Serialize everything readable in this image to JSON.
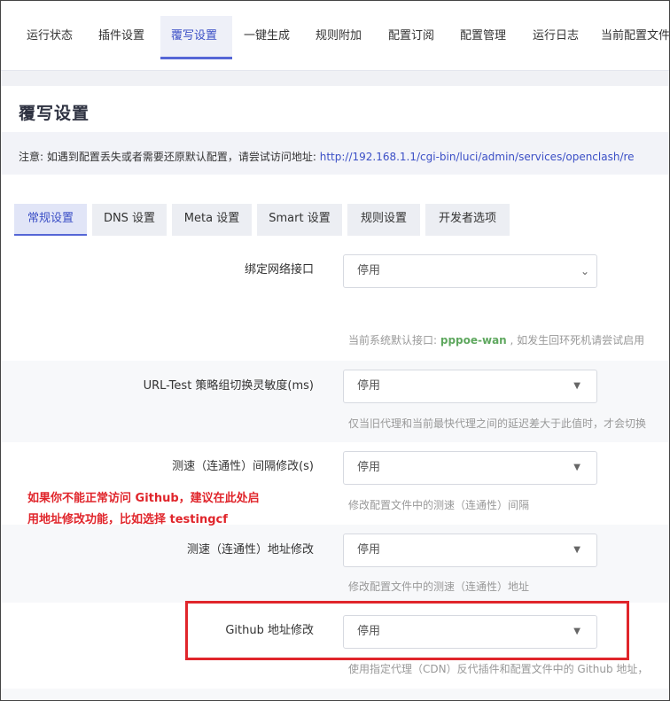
{
  "nav": {
    "items": [
      {
        "label": "运行状态"
      },
      {
        "label": "插件设置"
      },
      {
        "label": "覆写设置"
      },
      {
        "label": "一键生成"
      },
      {
        "label": "规则附加"
      },
      {
        "label": "配置订阅"
      },
      {
        "label": "配置管理"
      },
      {
        "label": "运行日志"
      },
      {
        "label": "当前配置文件"
      }
    ],
    "active_index": 2
  },
  "page": {
    "title": "覆写设置",
    "notice_prefix": "注意: 如遇到配置丢失或者需要还原默认配置，请尝试访问地址: ",
    "notice_link": "http://192.168.1.1/cgi-bin/luci/admin/services/openclash/re"
  },
  "tabs": [
    {
      "label": "常规设置"
    },
    {
      "label": "DNS 设置"
    },
    {
      "label": "Meta 设置"
    },
    {
      "label": "Smart 设置"
    },
    {
      "label": "规则设置"
    },
    {
      "label": "开发者选项"
    }
  ],
  "fields": [
    {
      "label": "绑定网络接口",
      "value": "停用",
      "desc_prefix": "当前系统默认接口: ",
      "desc_highlight": "pppoe-wan",
      "desc_suffix": " , 如发生回环死机请尝试启用"
    },
    {
      "label": "URL-Test 策略组切换灵敏度(ms)",
      "value": "停用",
      "desc": "仅当旧代理和当前最快代理之间的延迟差大于此值时，才会切换"
    },
    {
      "label": "测速（连通性）间隔修改(s)",
      "value": "停用",
      "desc": "修改配置文件中的测速（连通性）间隔"
    },
    {
      "label": "测速（连通性）地址修改",
      "value": "停用",
      "desc": "修改配置文件中的测速（连通性）地址"
    },
    {
      "label": "Github 地址修改",
      "value": "停用",
      "desc": "使用指定代理（CDN）反代插件和配置文件中的 Github 地址，"
    }
  ],
  "annotation": {
    "line1": "如果你不能正常访问 Github，建议在此处启",
    "line2": "用地址修改功能，比如选择 testingcf",
    "color": "#e0252b"
  },
  "colors": {
    "accent": "#3b4fc6",
    "highlight_green": "#5fa85f"
  }
}
